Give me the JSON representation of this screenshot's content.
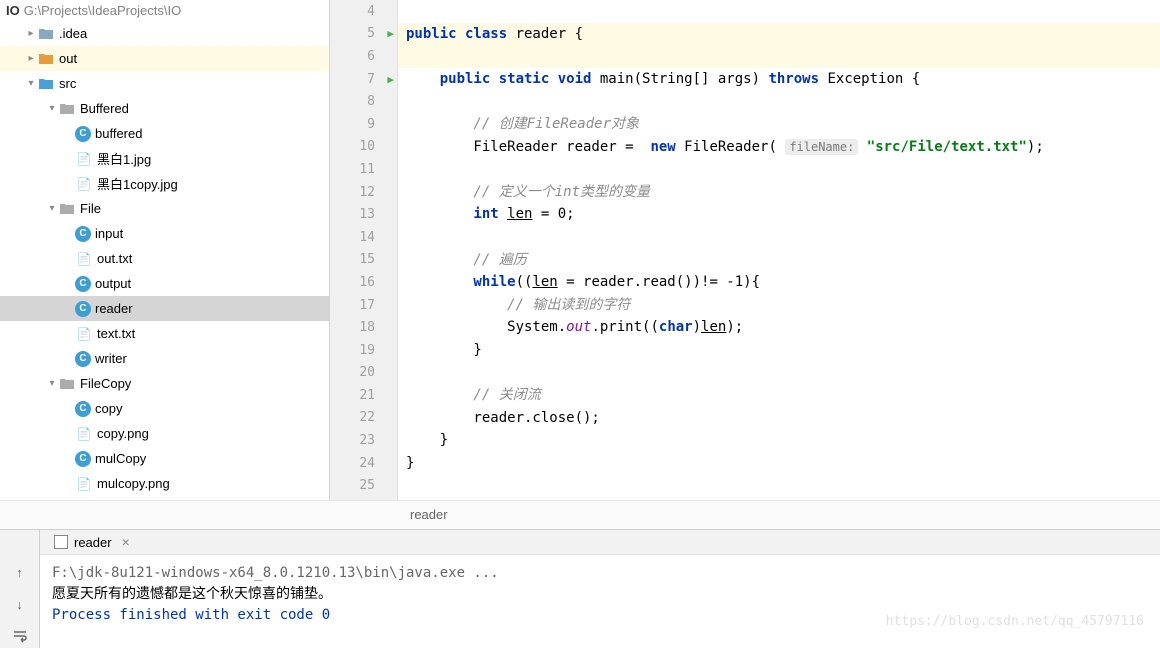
{
  "projectHeader": {
    "name": "IO",
    "path": "G:\\Projects\\IdeaProjects\\IO"
  },
  "tree": {
    "idea": ".idea",
    "out": "out",
    "src": "src",
    "buffered": "Buffered",
    "bufferedClass": "buffered",
    "hb1": "黑白1.jpg",
    "hb1copy": "黑白1copy.jpg",
    "file": "File",
    "input": "input",
    "outtxt": "out.txt",
    "output": "output",
    "reader": "reader",
    "texttxt": "text.txt",
    "writer": "writer",
    "filecopy": "FileCopy",
    "copy": "copy",
    "copypng": "copy.png",
    "mulCopy": "mulCopy",
    "mulcopypng": "mulcopy.png"
  },
  "code": {
    "lines": [
      "4",
      "5",
      "6",
      "7",
      "8",
      "9",
      "10",
      "11",
      "12",
      "13",
      "14",
      "15",
      "16",
      "17",
      "18",
      "19",
      "20",
      "21",
      "22",
      "23",
      "24",
      "25"
    ],
    "l5a": "public class ",
    "l5b": "reader {",
    "l7a": "    public static void ",
    "l7b": "main(String[] args) ",
    "l7c": "throws ",
    "l7d": "Exception {",
    "l9": "        // 创建FileReader对象",
    "l10a": "        FileReader reader =  ",
    "l10b": "new ",
    "l10c": "FileReader( ",
    "l10hint": "fileName:",
    "l10d": " \"src/File/text.txt\"",
    "l10e": ");",
    "l12": "        // 定义一个int类型的变量",
    "l13a": "        int ",
    "l13b": "len",
    "l13c": " = 0;",
    "l15": "        // 遍历",
    "l16a": "        while",
    "l16b": "((",
    "l16c": "len",
    "l16d": " = reader.read())!= -1){",
    "l17": "            // 输出读到的字符",
    "l18a": "            System.",
    "l18b": "out",
    "l18c": ".print((",
    "l18d": "char",
    "l18e": ")",
    "l18f": "len",
    "l18g": ");",
    "l19": "        }",
    "l21": "        // 关闭流",
    "l22": "        reader.close();",
    "l23": "    }",
    "l24": "}"
  },
  "breadcrumb": "reader",
  "console": {
    "tab": "reader",
    "cmd": "F:\\jdk-8u121-windows-x64_8.0.1210.13\\bin\\java.exe ...",
    "output": "愿夏天所有的遗憾都是这个秋天惊喜的铺垫。",
    "exit": "Process finished with exit code 0"
  },
  "watermark": "https://blog.csdn.net/qq_45797116"
}
